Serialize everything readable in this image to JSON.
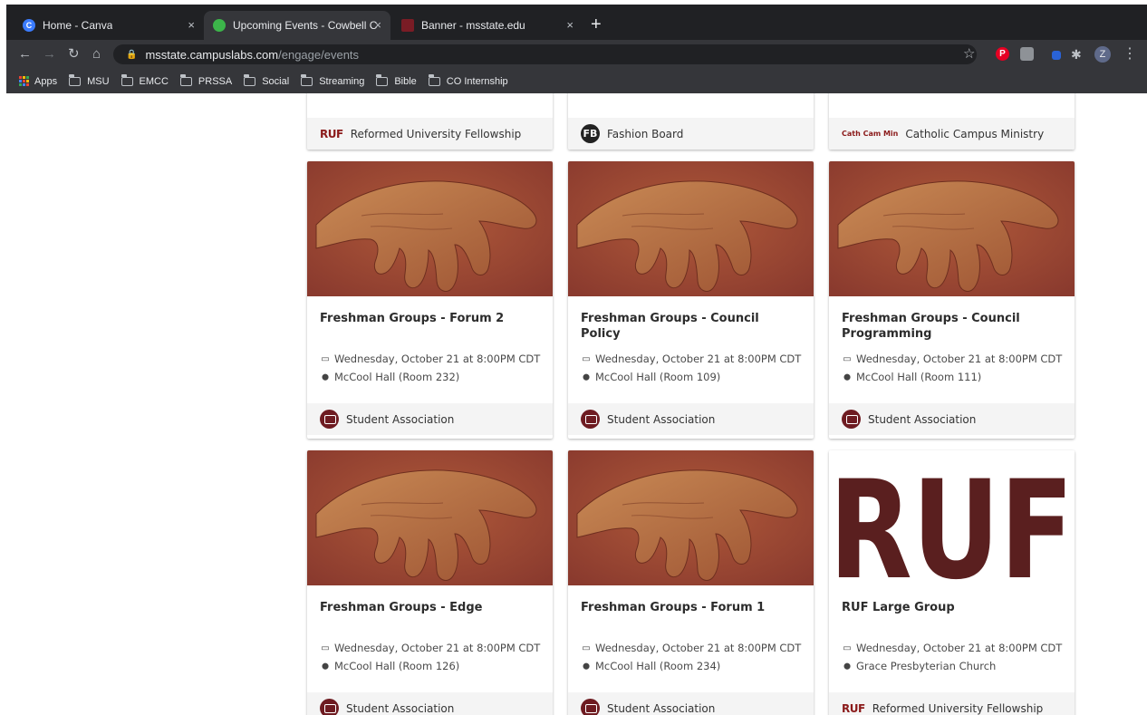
{
  "browser": {
    "tabs": [
      {
        "title": "Home - Canva",
        "favicon": "canva-icon",
        "active": false
      },
      {
        "title": "Upcoming Events - Cowbell Co",
        "favicon": "campuslabs-icon",
        "active": true
      },
      {
        "title": "Banner - msstate.edu",
        "favicon": "msstate-icon",
        "active": false
      }
    ],
    "new_tab_symbol": "+",
    "close_symbol": "×",
    "url_host": "msstate.campuslabs.com",
    "url_path": "/engage/events",
    "profile_initial": "Z",
    "bookmarks": [
      "Apps",
      "MSU",
      "EMCC",
      "PRSSA",
      "Social",
      "Streaming",
      "Bible",
      "CO Internship"
    ]
  },
  "colors": {
    "chrome_dark": "#202124",
    "chrome_toolbar": "#35363a",
    "maroon": "#6e1b21",
    "ruf_red": "#5a1f1f"
  },
  "top_row_orgs": [
    {
      "name": "Reformed University Fellowship",
      "logo": "ruf-logo"
    },
    {
      "name": "Fashion Board",
      "logo": "fashion-board-logo"
    },
    {
      "name": "Catholic Campus Ministry",
      "logo": "catholic-campus-ministry-logo"
    }
  ],
  "logo_text": {
    "ruf": "RUF",
    "fashion": "FB",
    "ccm": "Cath Cam Min"
  },
  "events": [
    {
      "title": "Freshman Groups - Forum 2",
      "date": "Wednesday, October 21 at 8:00PM CDT",
      "location": "McCool Hall (Room 232)",
      "org": "Student Association",
      "image": "hand"
    },
    {
      "title": "Freshman Groups - Council Policy",
      "date": "Wednesday, October 21 at 8:00PM CDT",
      "location": "McCool Hall (Room 109)",
      "org": "Student Association",
      "image": "hand"
    },
    {
      "title": "Freshman Groups - Council Programming",
      "date": "Wednesday, October 21 at 8:00PM CDT",
      "location": "McCool Hall (Room 111)",
      "org": "Student Association",
      "image": "hand"
    },
    {
      "title": "Freshman Groups - Edge",
      "date": "Wednesday, October 21 at 8:00PM CDT",
      "location": "McCool Hall (Room 126)",
      "org": "Student Association",
      "image": "hand"
    },
    {
      "title": "Freshman Groups - Forum 1",
      "date": "Wednesday, October 21 at 8:00PM CDT",
      "location": "McCool Hall (Room 234)",
      "org": "Student Association",
      "image": "hand"
    },
    {
      "title": "RUF Large Group",
      "date": "Wednesday, October 21 at 8:00PM CDT",
      "location": "Grace Presbyterian Church",
      "org": "Reformed University Fellowship",
      "image": "ruf-banner",
      "banner_text": "RUF"
    }
  ]
}
